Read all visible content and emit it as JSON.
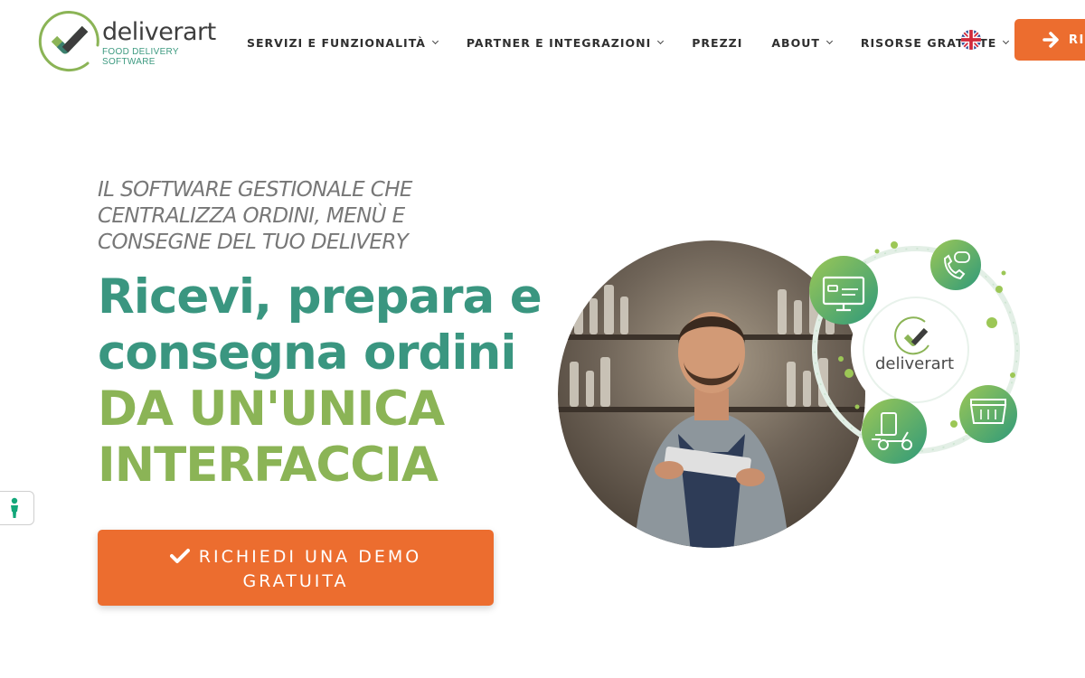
{
  "brand": {
    "name": "deliverart",
    "subtitle": "FOOD DELIVERY SOFTWARE",
    "green": "#3a9680",
    "lime": "#8bb456",
    "orange": "#ec6d2f"
  },
  "nav": {
    "items": [
      {
        "label": "SERVIZI E FUNZIONALITÀ",
        "dropdown": true
      },
      {
        "label": "PARTNER E INTEGRAZIONI",
        "dropdown": true
      },
      {
        "label": "PREZZI",
        "dropdown": false
      },
      {
        "label": "ABOUT",
        "dropdown": true
      },
      {
        "label": "RISORSE GRATUITE",
        "dropdown": true
      }
    ],
    "language_icon": "uk-flag-icon",
    "cta_label": "RIC"
  },
  "hero": {
    "tagline": "IL SOFTWARE GESTIONALE CHE CENTRALIZZA ORDINI, MENÙ E CONSEGNE DEL TUO DELIVERY",
    "headline_line1": "Ricevi, prepara e",
    "headline_line2": "consegna ordini",
    "headline_line3": "DA UN'UNICA",
    "headline_line4": "INTERFACCIA",
    "cta_line1": "RICHIEDI UNA DEMO",
    "cta_line2": "GRATUITA",
    "illustration_brand": "deliverart",
    "feature_icons": [
      "pos-monitor-icon",
      "phone-order-icon",
      "scooter-delivery-icon",
      "menu-card-icon"
    ]
  },
  "accessibility": {
    "icon": "accessibility-person-icon"
  }
}
